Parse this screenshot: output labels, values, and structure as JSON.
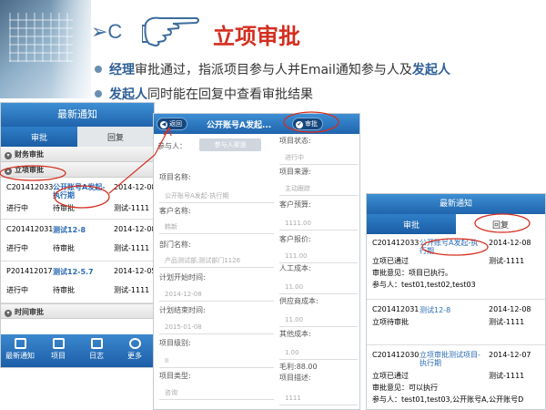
{
  "slide": {
    "section": "➢C",
    "title": "立项审批",
    "bullet1_prefix": "经理",
    "bullet1_text": "审批通过，指派项目参与人并Email通知参与人及",
    "bullet1_suffix": "发起人",
    "bullet2_prefix": "发起人",
    "bullet2_text": "同时能在回复中查看审批结果"
  },
  "panel1": {
    "title": "最新通知",
    "tab_approve": "审批",
    "tab_reply": "回复",
    "group_finance": "财务审批",
    "group_project": "立项审批",
    "group_time": "时间审批",
    "records": [
      {
        "id": "C201412033",
        "name": "公开账号A发起-执行期",
        "date": "2014-12-08",
        "status": "进行中",
        "state": "待审批",
        "assignee": "测试-1111"
      },
      {
        "id": "C201412031",
        "name": "测试12-8",
        "date": "2014-12-08",
        "status": "进行中",
        "state": "待审批",
        "assignee": "测试-1111"
      },
      {
        "id": "P201412017",
        "name": "测试12-5.7",
        "date": "2014-12-05",
        "status": "进行中",
        "state": "待审批",
        "assignee": "测试-1111"
      }
    ],
    "tabs": [
      "最新通知",
      "项目",
      "日志",
      "更多"
    ]
  },
  "panel2": {
    "back": "返回",
    "header": "公开账号A发起...",
    "approve": "审批",
    "participant_label": "参与人：",
    "participant_button": "参与人渠道",
    "left_fields": [
      {
        "label": "项目名称:",
        "value": "公开账号A发起-执行期"
      },
      {
        "label": "客户名称:",
        "value": "韩新"
      },
      {
        "label": "部门名称:",
        "value": "产品测试部,测试部门1126"
      },
      {
        "label": "计划开始时间:",
        "value": "2014-12-08"
      },
      {
        "label": "计划结束时间:",
        "value": "2015-01-08"
      },
      {
        "label": "项目级别:",
        "value": "II"
      },
      {
        "label": "项目类型:",
        "value": "咨询"
      }
    ],
    "right_fields": [
      {
        "label": "项目状态:",
        "value": "进行中"
      },
      {
        "label": "项目来源:",
        "value": "主动跟踪"
      },
      {
        "label": "客户预算:",
        "value": "1111.00"
      },
      {
        "label": "客户报价:",
        "value": "111.00"
      },
      {
        "label": "人工成本:",
        "value": "11.00"
      },
      {
        "label": "供应商成本:",
        "value": "11.00"
      },
      {
        "label": "其他成本:",
        "value": "1.00"
      },
      {
        "label": "毛利:88.00",
        "value": ""
      },
      {
        "label": "项目描述:",
        "value": "1111"
      }
    ]
  },
  "panel3": {
    "title": "最新通知",
    "tab_approve": "审批",
    "tab_reply": "回复",
    "records": [
      {
        "id": "C201412033",
        "name": "公开账号A发起-执行期",
        "date": "2014-12-08",
        "status": "立项已通过",
        "assignee": "测试-1111",
        "opinion": "审批意见：项目已执行。",
        "participants": "参与人：test01,test02,test03"
      },
      {
        "id": "C201412031",
        "name": "测试12-8",
        "date": "2014-12-08",
        "status": "立项待审批",
        "assignee": "测试-1111",
        "opinion": "",
        "participants": ""
      },
      {
        "id": "C201412030",
        "name": "立项审批测试项目-执行期",
        "date": "2014-12-07",
        "status": "立项已通过",
        "assignee": "测试-1111",
        "opinion": "审批意见：可以执行",
        "participants": "参与人：test01,test03,公开账号A,公开账号D"
      }
    ]
  },
  "colors": {
    "accent_red": "#d42e1f",
    "brand_blue": "#1f64ad",
    "link": "#2a6bb6"
  }
}
